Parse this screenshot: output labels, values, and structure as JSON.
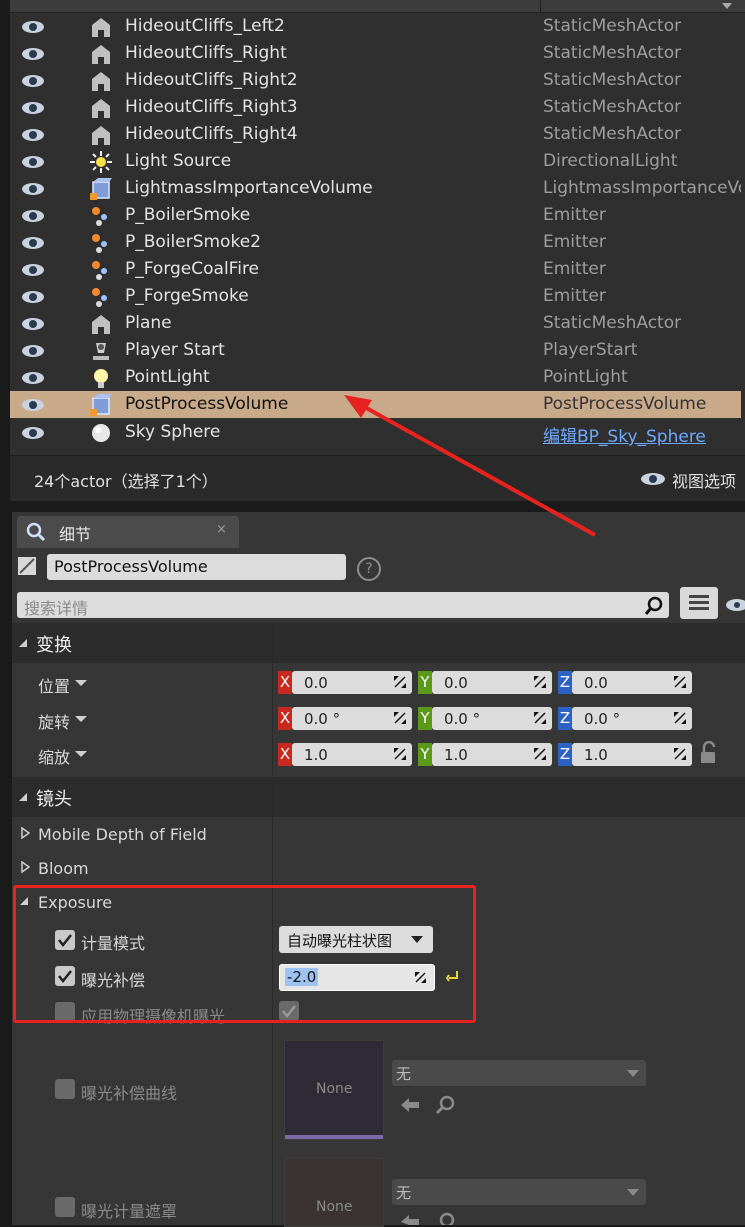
{
  "outliner": {
    "rows": [
      {
        "name": "HideoutCliffs_Left2",
        "type": "StaticMeshActor",
        "icon": "static-mesh-icon"
      },
      {
        "name": "HideoutCliffs_Right",
        "type": "StaticMeshActor",
        "icon": "static-mesh-icon"
      },
      {
        "name": "HideoutCliffs_Right2",
        "type": "StaticMeshActor",
        "icon": "static-mesh-icon"
      },
      {
        "name": "HideoutCliffs_Right3",
        "type": "StaticMeshActor",
        "icon": "static-mesh-icon"
      },
      {
        "name": "HideoutCliffs_Right4",
        "type": "StaticMeshActor",
        "icon": "static-mesh-icon"
      },
      {
        "name": "Light Source",
        "type": "DirectionalLight",
        "icon": "directional-light-icon"
      },
      {
        "name": "LightmassImportanceVolume",
        "type": "LightmassImportanceVo",
        "icon": "volume-icon"
      },
      {
        "name": "P_BoilerSmoke",
        "type": "Emitter",
        "icon": "emitter-icon"
      },
      {
        "name": "P_BoilerSmoke2",
        "type": "Emitter",
        "icon": "emitter-icon"
      },
      {
        "name": "P_ForgeCoalFire",
        "type": "Emitter",
        "icon": "emitter-icon"
      },
      {
        "name": "P_ForgeSmoke",
        "type": "Emitter",
        "icon": "emitter-icon"
      },
      {
        "name": "Plane",
        "type": "StaticMeshActor",
        "icon": "static-mesh-icon"
      },
      {
        "name": "Player Start",
        "type": "PlayerStart",
        "icon": "player-start-icon"
      },
      {
        "name": "PointLight",
        "type": "PointLight",
        "icon": "point-light-icon"
      },
      {
        "name": "PostProcessVolume",
        "type": "PostProcessVolume",
        "icon": "volume-icon",
        "selected": true
      },
      {
        "name": "Sky Sphere",
        "type": "编辑BP_Sky_Sphere",
        "icon": "sphere-icon",
        "link": true
      }
    ],
    "footer_count": "24个actor（选择了1个）",
    "view_options": "视图选项"
  },
  "details": {
    "tab_label": "细节",
    "actor_name": "PostProcessVolume",
    "search_placeholder": "搜索详情",
    "transform": {
      "header": "变换",
      "location_label": "位置",
      "rotation_label": "旋转",
      "scale_label": "缩放",
      "location": {
        "x": "0.0",
        "y": "0.0",
        "z": "0.0"
      },
      "rotation": {
        "x": "0.0 °",
        "y": "0.0 °",
        "z": "0.0 °"
      },
      "scale": {
        "x": "1.0",
        "y": "1.0",
        "z": "1.0"
      }
    },
    "lens": {
      "header": "镜头",
      "mobile_dof": "Mobile Depth of Field",
      "bloom": "Bloom",
      "exposure": "Exposure",
      "metering_mode_label": "计量模式",
      "metering_mode_value": "自动曝光柱状图",
      "exposure_comp_label": "曝光补偿",
      "exposure_comp_value": "-2.0",
      "apply_physical_label": "应用物理摄像机曝光",
      "exposure_curve_label": "曝光补偿曲线",
      "exposure_mask_label": "曝光计量遮罩",
      "asset_none": "None",
      "asset_dropdown_value": "无"
    }
  },
  "annotations": {
    "highlight_color": "#e8231f"
  }
}
